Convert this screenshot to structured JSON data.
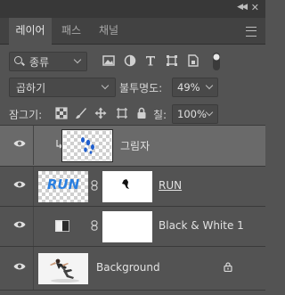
{
  "tabs": [
    {
      "label": "레이어",
      "active": true
    },
    {
      "label": "패스",
      "active": false
    },
    {
      "label": "채널",
      "active": false
    }
  ],
  "filter": {
    "kind_label": "종류",
    "icons": [
      "image-filter-icon",
      "adjustment-filter-icon",
      "type-filter-icon",
      "shape-filter-icon",
      "smart-object-filter-icon",
      "filter-toggle-icon"
    ]
  },
  "blend": {
    "mode": "곱하기",
    "opacity_label": "불투명도:",
    "opacity_value": "49%"
  },
  "lock": {
    "label": "잠그기:",
    "fill_label": "칠:",
    "fill_value": "100%"
  },
  "layers": [
    {
      "name": "그림자",
      "selected": true,
      "clipped": true,
      "visible": true
    },
    {
      "name": "RUN",
      "selected": false,
      "visible": true,
      "thumb_text": "RUN",
      "has_mask": true
    },
    {
      "name": "Black & White 1",
      "selected": false,
      "visible": true,
      "adjustment": true,
      "has_mask": true
    },
    {
      "name": "Background",
      "selected": false,
      "visible": true,
      "locked": true
    }
  ],
  "colors": {
    "panel_bg": "#535353",
    "selected_row": "#6a6a6a",
    "run_text_blue": "#2a7fe0"
  }
}
